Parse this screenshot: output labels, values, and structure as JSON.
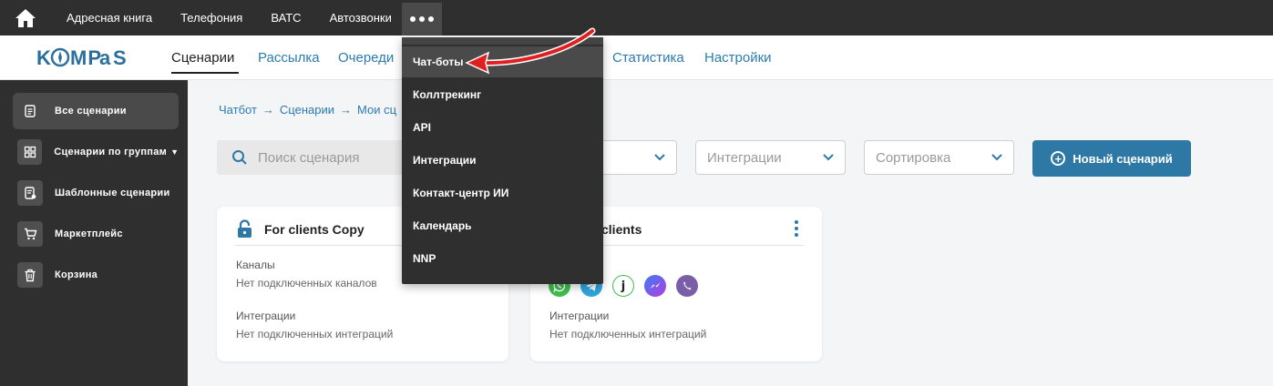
{
  "topbar": {
    "items": [
      "Адресная книга",
      "Телефония",
      "ВАТС",
      "Автозвонки"
    ]
  },
  "logo": "KOMPaS",
  "nav": {
    "items": [
      "Сценарии",
      "Рассылка",
      "Очереди",
      "Статистика",
      "Настройки"
    ],
    "active": "Сценарии"
  },
  "sidebar": {
    "items": [
      {
        "label": "Все сценарии",
        "icon": "document-icon",
        "active": true
      },
      {
        "label": "Сценарии по группам",
        "icon": "grid-icon"
      },
      {
        "label": "Шаблонные сценарии",
        "icon": "template-icon"
      },
      {
        "label": "Маркетплейс",
        "icon": "cart-icon"
      },
      {
        "label": "Корзина",
        "icon": "trash-icon"
      }
    ]
  },
  "breadcrumb": [
    "Чатбот",
    "Сценарии",
    "Мои сц"
  ],
  "filters": {
    "search_placeholder": "Поиск сценария",
    "integrations_placeholder": "Интеграции",
    "sort_placeholder": "Сортировка"
  },
  "new_button": "Новый сценарий",
  "cards": [
    {
      "title": "For clients Copy",
      "channels_label": "Каналы",
      "channels_value": "Нет подключенных каналов",
      "integrations_label": "Интеграции",
      "integrations_value": "Нет подключенных интеграций"
    },
    {
      "title": "clients",
      "integrations_label": "Интеграции",
      "integrations_value": "Нет подключенных интеграций",
      "channels": [
        "whatsapp-icon",
        "telegram-icon",
        "jivo-icon",
        "messenger-icon",
        "viber-icon"
      ]
    }
  ],
  "dropdown": {
    "items": [
      "Чат-боты",
      "Коллтрекинг",
      "API",
      "Интеграции",
      "Контакт-центр ИИ",
      "Календарь",
      "NNP"
    ],
    "hovered": "Чат-боты"
  },
  "colors": {
    "dark": "#2f2f2f",
    "accent": "#2e78a6",
    "link": "#2c7bb0",
    "arrow": "#e02020"
  }
}
